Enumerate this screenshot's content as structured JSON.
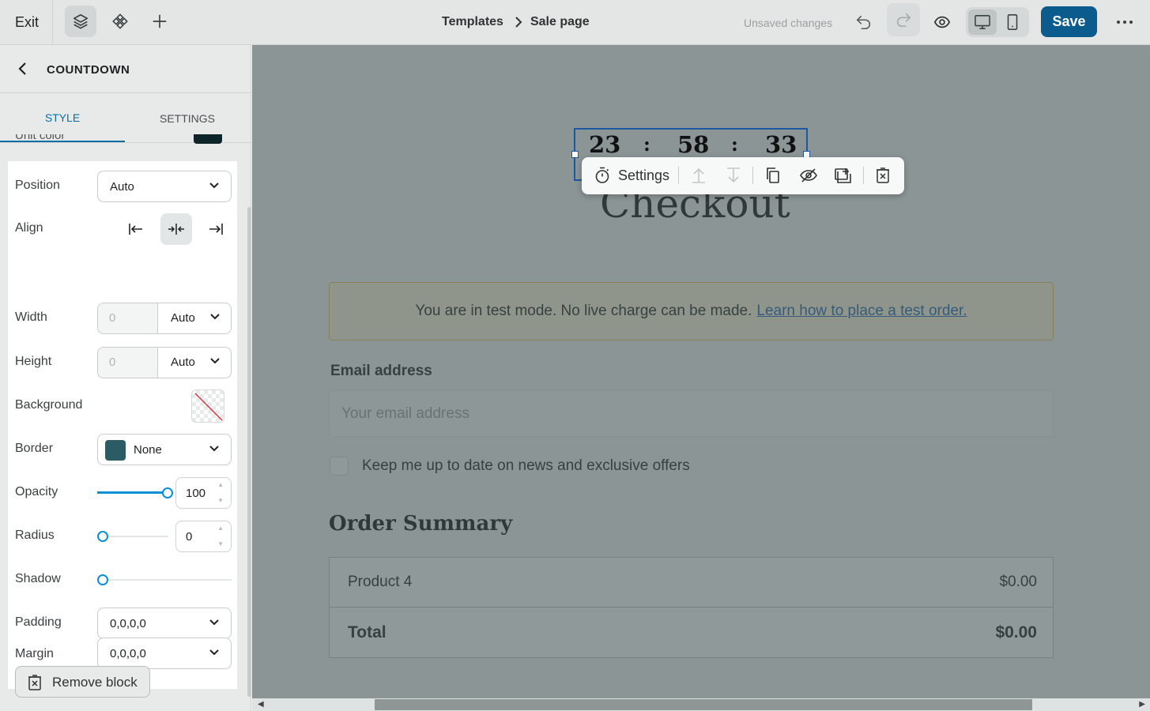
{
  "topbar": {
    "exit_label": "Exit",
    "breadcrumb": {
      "parent": "Templates",
      "current": "Sale page"
    },
    "status": "Unsaved changes",
    "save_label": "Save"
  },
  "sidebar": {
    "title": "COUNTDOWN",
    "tabs": [
      "STYLE",
      "SETTINGS"
    ],
    "active_tab": "STYLE",
    "partial_row_label": "Unit color",
    "unit_color": "#0d2428",
    "fields": {
      "position": {
        "label": "Position",
        "value": "Auto"
      },
      "align": {
        "label": "Align",
        "selected": "center"
      },
      "width": {
        "label": "Width",
        "placeholder": "0",
        "unit": "Auto"
      },
      "height": {
        "label": "Height",
        "placeholder": "0",
        "unit": "Auto"
      },
      "background": {
        "label": "Background",
        "value": "transparent"
      },
      "border": {
        "label": "Border",
        "value": "None",
        "color": "#2b5c66"
      },
      "opacity": {
        "label": "Opacity",
        "value": "100",
        "level": 1.0
      },
      "radius": {
        "label": "Radius",
        "value": "0",
        "level": 0
      },
      "shadow": {
        "label": "Shadow",
        "level": 0
      },
      "padding": {
        "label": "Padding",
        "value": "0,0,0,0"
      },
      "margin": {
        "label": "Margin",
        "value": "0,0,0,0"
      }
    },
    "remove_label": "Remove block"
  },
  "canvas": {
    "countdown": {
      "hours": "23",
      "minutes": "58",
      "seconds": "33",
      "separator": ":"
    },
    "block_toolbar": {
      "settings_label": "Settings"
    },
    "heading": "Checkout",
    "test_banner": {
      "text": "You are in test mode. No live charge can be made.",
      "link": "Learn how to place a test order."
    },
    "email": {
      "label": "Email address",
      "placeholder": "Your email address"
    },
    "newsletter_label": "Keep me up to date on news and exclusive offers",
    "order_summary": {
      "title": "Order Summary",
      "rows": [
        {
          "name": "Product 4",
          "price": "$0.00"
        },
        {
          "name": "Total",
          "price": "$0.00"
        }
      ]
    }
  },
  "colors": {
    "accent": "#0a8fd6",
    "save_bg": "#0b5c8c",
    "selection": "#1b58a0",
    "warning_border": "#e3c561"
  }
}
